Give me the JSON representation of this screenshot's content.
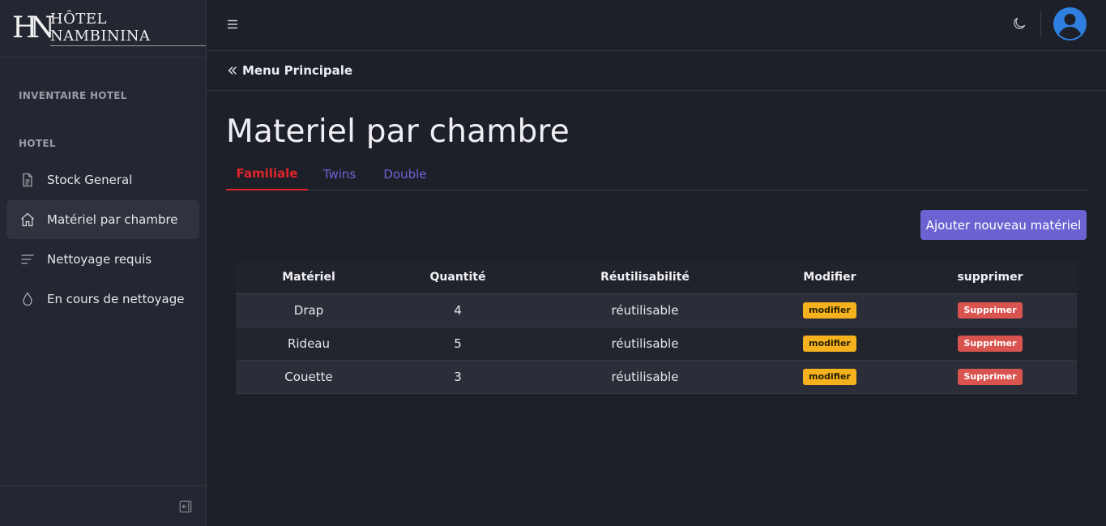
{
  "brand": {
    "mark": "HN",
    "name": "HÔTEL NAMBININA"
  },
  "sidebar": {
    "section1": "INVENTAIRE HOTEL",
    "section2": "HOTEL",
    "items": [
      {
        "label": "Stock General",
        "icon": "document-icon"
      },
      {
        "label": "Matériel par chambre",
        "icon": "home-icon",
        "active": true
      },
      {
        "label": "Nettoyage requis",
        "icon": "lines-icon"
      },
      {
        "label": "En cours de nettoyage",
        "icon": "droplet-icon"
      }
    ]
  },
  "breadcrumb": {
    "label": "Menu Principale"
  },
  "page": {
    "title": "Materiel par chambre"
  },
  "tabs": [
    {
      "label": "Familiale",
      "active": true
    },
    {
      "label": "Twins"
    },
    {
      "label": "Double"
    }
  ],
  "actions": {
    "add_label": "Ajouter nouveau matériel"
  },
  "table": {
    "headers": [
      "Matériel",
      "Quantité",
      "Réutilisabilité",
      "Modifier",
      "supprimer"
    ],
    "rows": [
      {
        "materiel": "Drap",
        "quantite": "4",
        "reutilisabilite": "réutilisable",
        "edit": "modifier",
        "delete": "Supprimer"
      },
      {
        "materiel": "Rideau",
        "quantite": "5",
        "reutilisabilite": "réutilisable",
        "edit": "modifier",
        "delete": "Supprimer"
      },
      {
        "materiel": "Couette",
        "quantite": "3",
        "reutilisabilite": "réutilisable",
        "edit": "modifier",
        "delete": "Supprimer"
      }
    ]
  },
  "colors": {
    "accent": "#6c63d3",
    "active_tab": "#e0242a",
    "edit_badge": "#f5b11e",
    "delete_badge": "#d9534f",
    "avatar": "#2f7fe0"
  }
}
